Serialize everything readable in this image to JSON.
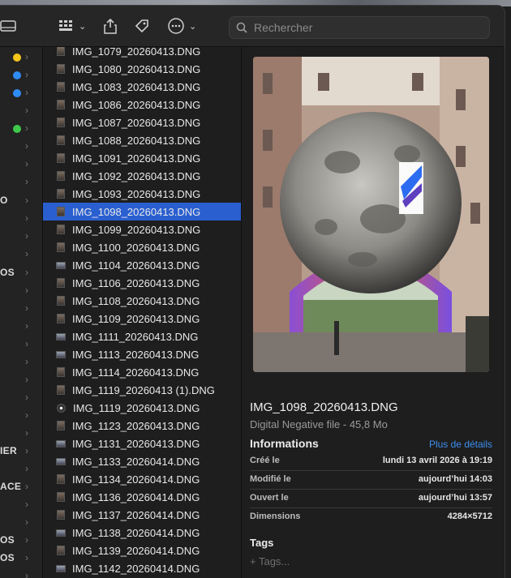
{
  "search": {
    "placeholder": "Rechercher"
  },
  "sidebar": {
    "partial_labels": [
      "O",
      "OS",
      "IER",
      "ACE",
      "OS",
      "OS"
    ],
    "dots": [
      "#f5c518",
      "#2f8cf5",
      "#2f8cf5",
      "#3ec94a"
    ]
  },
  "files": [
    "IMG_1079_20260413.DNG",
    "IMG_1080_20260413.DNG",
    "IMG_1083_20260413.DNG",
    "IMG_1086_20260413.DNG",
    "IMG_1087_20260413.DNG",
    "IMG_1088_20260413.DNG",
    "IMG_1091_20260413.DNG",
    "IMG_1092_20260413.DNG",
    "IMG_1093_20260413.DNG",
    "IMG_1098_20260413.DNG",
    "IMG_1099_20260413.DNG",
    "IMG_1100_20260413.DNG",
    "IMG_1104_20260413.DNG",
    "IMG_1106_20260413.DNG",
    "IMG_1108_20260413.DNG",
    "IMG_1109_20260413.DNG",
    "IMG_1111_20260413.DNG",
    "IMG_1113_20260413.DNG",
    "IMG_1114_20260413.DNG",
    "IMG_1119_20260413 (1).DNG",
    "IMG_1119_20260413.DNG",
    "IMG_1123_20260413.DNG",
    "IMG_1131_20260413.DNG",
    "IMG_1133_20260414.DNG",
    "IMG_1134_20260414.DNG",
    "IMG_1136_20260414.DNG",
    "IMG_1137_20260414.DNG",
    "IMG_1138_20260414.DNG",
    "IMG_1139_20260414.DNG",
    "IMG_1142_20260414.DNG"
  ],
  "selected_file": "IMG_1098_20260413.DNG",
  "preview": {
    "filename": "IMG_1098_20260413.DNG",
    "kind": "Digital Negative file - 45,8 Mo",
    "info_title": "Informations",
    "more_link": "Plus de détails",
    "fields": [
      {
        "label": "Créé le",
        "value": "lundi 13 avril 2026 à 19:19"
      },
      {
        "label": "Modifié le",
        "value": "aujourd’hui 14:03"
      },
      {
        "label": "Ouvert le",
        "value": "aujourd’hui 13:57"
      },
      {
        "label": "Dimensions",
        "value": "4284×5712"
      }
    ],
    "tags_title": "Tags",
    "tags_placeholder": "+ Tags..."
  },
  "colors": {
    "selection": "#2a5fd0",
    "link": "#3d8ef0"
  }
}
